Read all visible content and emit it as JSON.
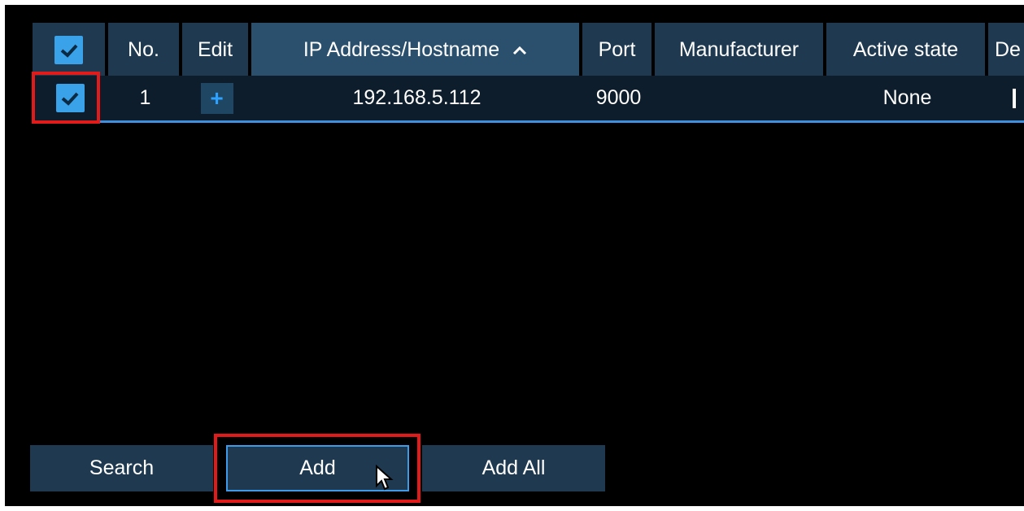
{
  "table": {
    "headers": {
      "no": "No.",
      "edit": "Edit",
      "ip": "IP Address/Hostname",
      "port": "Port",
      "manufacturer": "Manufacturer",
      "active_state": "Active state",
      "truncated": "De"
    },
    "sort_indicator": "chevron-up-icon",
    "rows": [
      {
        "no": "1",
        "edit": "+",
        "ip": "192.168.5.112",
        "port": "9000",
        "manufacturer": "",
        "active_state": "None",
        "checked": true
      }
    ]
  },
  "buttons": {
    "search": "Search",
    "add": "Add",
    "add_all": "Add All"
  },
  "colors": {
    "header_bg": "#1f3a50",
    "row_bg": "#0d1d2b",
    "accent": "#3aa2e8",
    "highlight": "#e11a1a"
  }
}
